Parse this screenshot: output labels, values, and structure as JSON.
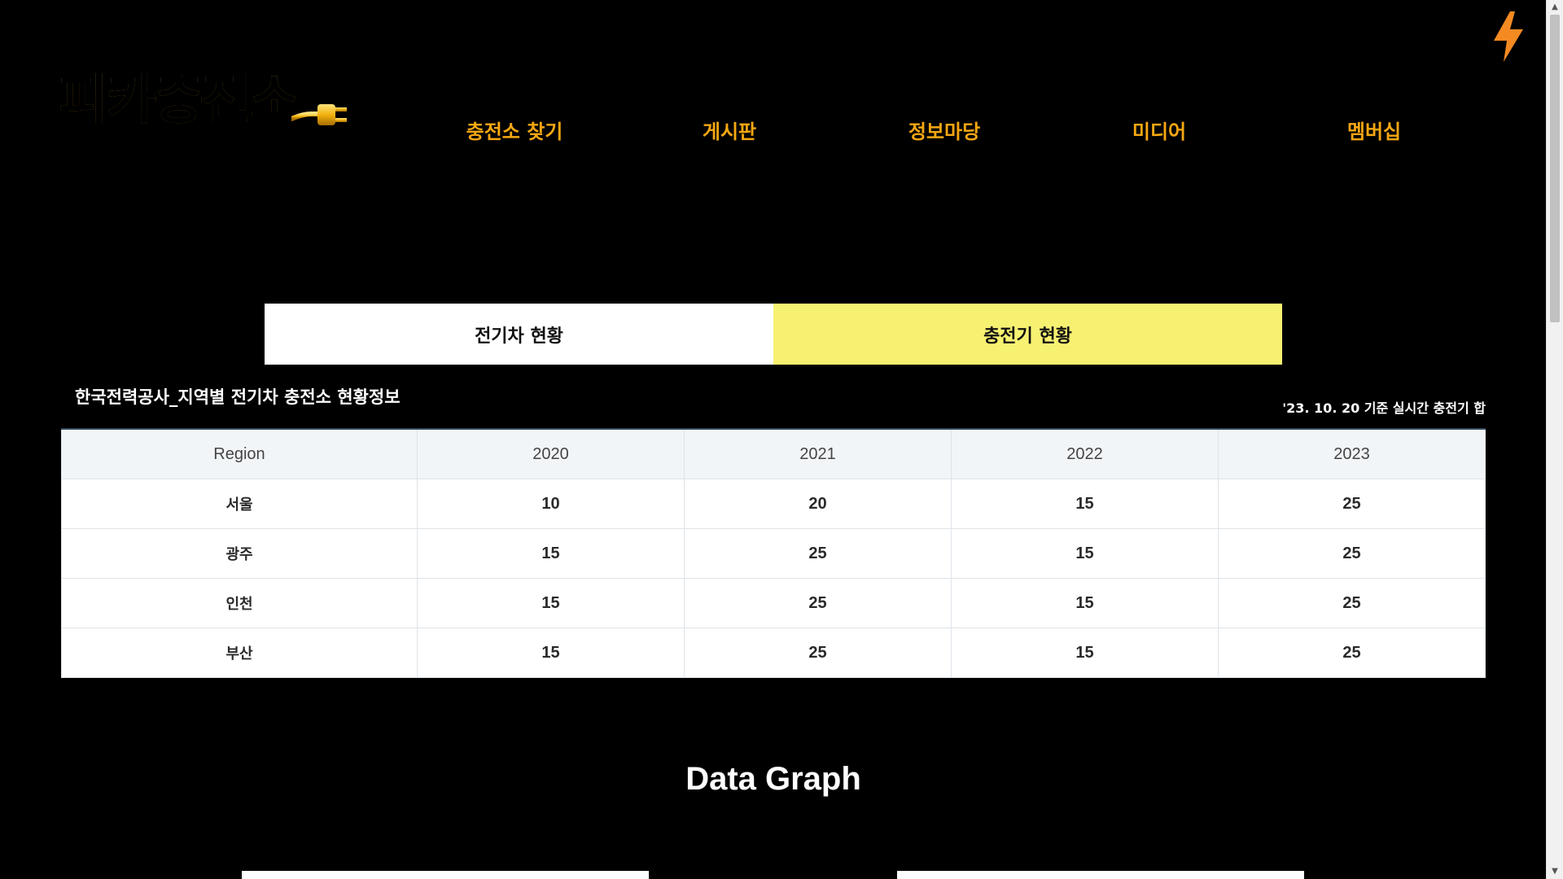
{
  "logo": {
    "text": "피카충전소"
  },
  "nav": {
    "items": [
      {
        "label": "충전소 찾기"
      },
      {
        "label": "게시판"
      },
      {
        "label": "정보마당"
      },
      {
        "label": "미디어"
      },
      {
        "label": "멤버십"
      }
    ]
  },
  "tabs": {
    "ev_status": "전기차 현황",
    "charger_status": "충전기 현황",
    "active": "charger_status"
  },
  "table": {
    "title": "한국전력공사_지역별 전기차 충전소 현황정보",
    "note": "'23. 10. 20 기준 실시간 충전기 합",
    "headers": [
      "Region",
      "2020",
      "2021",
      "2022",
      "2023"
    ],
    "rows": [
      [
        "서울",
        "10",
        "20",
        "15",
        "25"
      ],
      [
        "광주",
        "15",
        "25",
        "15",
        "25"
      ],
      [
        "인천",
        "15",
        "25",
        "15",
        "25"
      ],
      [
        "부산",
        "15",
        "25",
        "15",
        "25"
      ]
    ]
  },
  "graph": {
    "title": "Data Graph"
  },
  "colors": {
    "background": "#000000",
    "nav_text": "#f5a712",
    "active_tab": "#f7f171",
    "bolt": "#f58a22"
  },
  "icons": {
    "bolt": "lightning-bolt-icon",
    "plug": "plug-icon"
  }
}
